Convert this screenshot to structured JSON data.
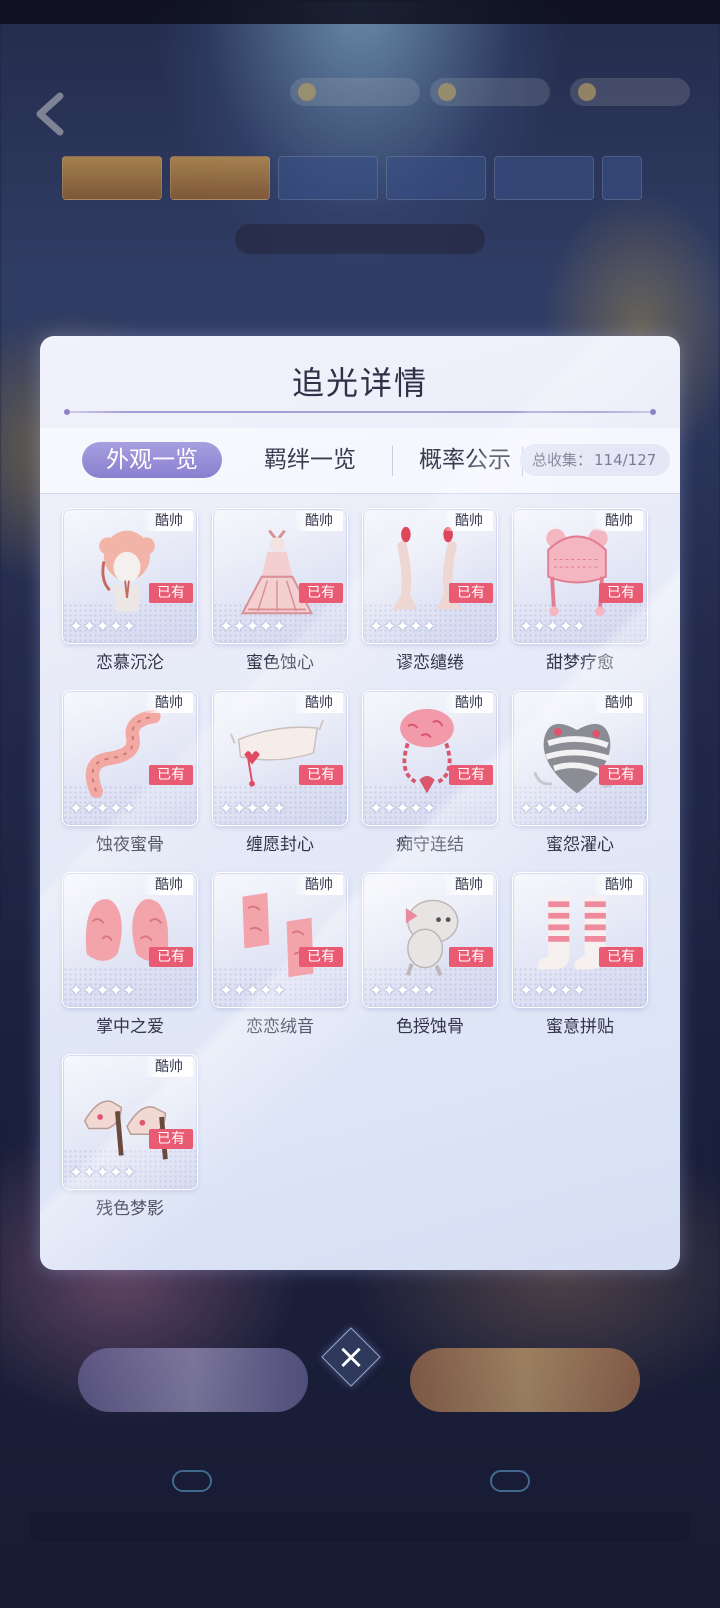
{
  "dialog": {
    "title": "追光详情",
    "tabs": [
      "外观一览",
      "羁绊一览",
      "概率公示"
    ],
    "collection_label": "总收集：",
    "collection_value": "114/127"
  },
  "items": [
    {
      "name": "恋慕沉沦",
      "style_tag": "酷帅",
      "owned_tag": "已有",
      "stars": 5,
      "icon": "hairstyle-icon",
      "colors": {
        "main": "#f1b4a6",
        "accent": "#c66a5e"
      }
    },
    {
      "name": "蜜色蚀心",
      "style_tag": "酷帅",
      "owned_tag": "已有",
      "stars": 5,
      "icon": "dress-icon",
      "colors": {
        "main": "#f3cfd0",
        "accent": "#d88f95"
      }
    },
    {
      "name": "谬恋缱绻",
      "style_tag": "酷帅",
      "owned_tag": "已有",
      "stars": 5,
      "icon": "earrings-icon",
      "colors": {
        "main": "#eed7d3",
        "accent": "#e0465a"
      }
    },
    {
      "name": "甜梦疗愈",
      "style_tag": "酷帅",
      "owned_tag": "已有",
      "stars": 5,
      "icon": "knit-hat-icon",
      "colors": {
        "main": "#f4b6c1",
        "accent": "#e27d92"
      }
    },
    {
      "name": "蚀夜蜜骨",
      "style_tag": "酷帅",
      "owned_tag": "已有",
      "stars": 5,
      "icon": "tail-icon",
      "colors": {
        "main": "#f2a9a3",
        "accent": "#c77a74"
      }
    },
    {
      "name": "缠愿封心",
      "style_tag": "酷帅",
      "owned_tag": "已有",
      "stars": 5,
      "icon": "mask-icon",
      "colors": {
        "main": "#f6ecea",
        "accent": "#e04a63"
      }
    },
    {
      "name": "痴守连结",
      "style_tag": "酷帅",
      "owned_tag": "已有",
      "stars": 5,
      "icon": "chain-bag-icon",
      "colors": {
        "main": "#f29aaa",
        "accent": "#d9566f"
      }
    },
    {
      "name": "蜜怨濯心",
      "style_tag": "酷帅",
      "owned_tag": "已有",
      "stars": 5,
      "icon": "heart-ring-icon",
      "colors": {
        "main": "#8c8c94",
        "accent": "#e5516b"
      }
    },
    {
      "name": "掌中之爱",
      "style_tag": "酷帅",
      "owned_tag": "已有",
      "stars": 5,
      "icon": "fur-gloves-icon",
      "colors": {
        "main": "#f3a4ab",
        "accent": "#d97683"
      }
    },
    {
      "name": "恋恋绒音",
      "style_tag": "酷帅",
      "owned_tag": "已有",
      "stars": 5,
      "icon": "leg-warmers-icon",
      "colors": {
        "main": "#f3a4ab",
        "accent": "#d97683"
      }
    },
    {
      "name": "色授蚀骨",
      "style_tag": "酷帅",
      "owned_tag": "已有",
      "stars": 5,
      "icon": "plush-charm-icon",
      "colors": {
        "main": "#e8e4e4",
        "accent": "#e88aa0"
      }
    },
    {
      "name": "蜜意拼贴",
      "style_tag": "酷帅",
      "owned_tag": "已有",
      "stars": 5,
      "icon": "striped-socks-icon",
      "colors": {
        "main": "#f7f0f0",
        "accent": "#ef8a9c"
      }
    },
    {
      "name": "残色梦影",
      "style_tag": "酷帅",
      "owned_tag": "已有",
      "stars": 5,
      "icon": "heels-icon",
      "colors": {
        "main": "#f2d8d3",
        "accent": "#6b4a3e"
      }
    }
  ],
  "close_label": "×"
}
